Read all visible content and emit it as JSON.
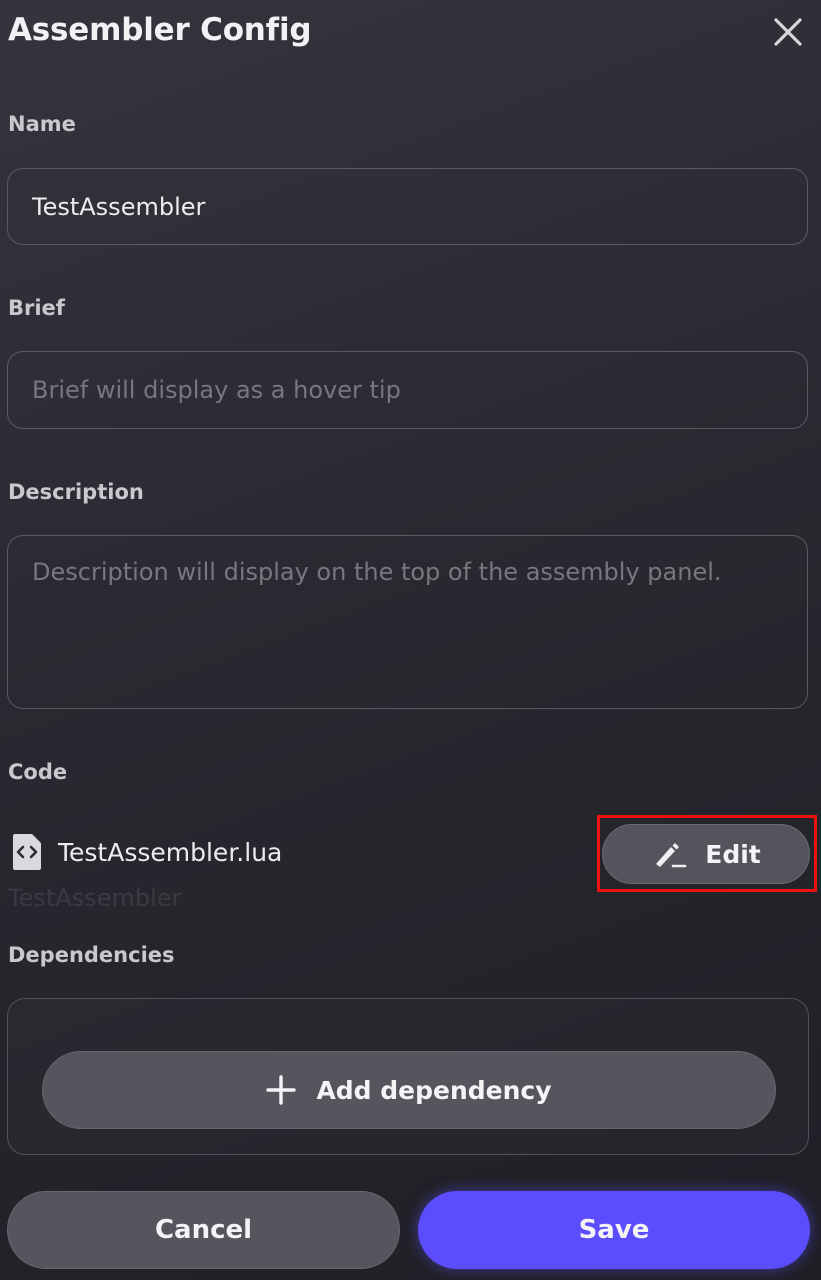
{
  "dialog": {
    "title": "Assembler Config"
  },
  "name": {
    "label": "Name",
    "value": "TestAssembler"
  },
  "brief": {
    "label": "Brief",
    "placeholder": "Brief will display as a hover tip"
  },
  "description": {
    "label": "Description",
    "placeholder": "Description will display on the top of the assembly panel."
  },
  "code": {
    "label": "Code",
    "file_name": "TestAssembler.lua",
    "file_icon": "code-file-icon",
    "edit_label": "Edit",
    "edit_icon": "pencil-icon",
    "ghost_text": "TestAssembler"
  },
  "dependencies": {
    "label": "Dependencies",
    "add_label": "Add dependency",
    "add_icon": "plus-icon"
  },
  "footer": {
    "cancel_label": "Cancel",
    "save_label": "Save"
  },
  "colors": {
    "accent": "#5b4dfb",
    "highlight": "#ee1111"
  }
}
